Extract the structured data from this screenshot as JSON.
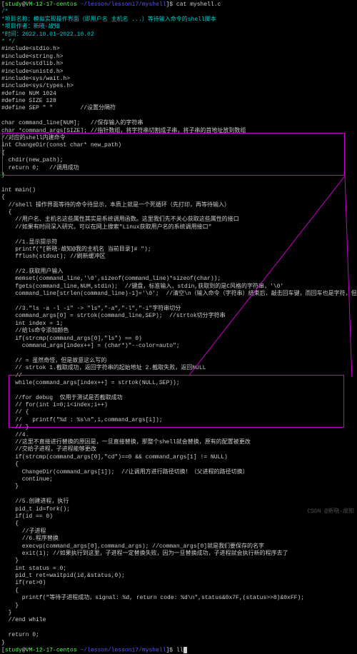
{
  "prompt1": {
    "user": "study",
    "host": "VM-12-17-centos",
    "path": "~/lesson/lesson17/myshell",
    "cmd": "cat myshell.c"
  },
  "header_comments": [
    "/*",
    "*项目名称：模拟实现操作界面（即用户名 主机名 ...）等待输入命令的shell脚本",
    "*项目作者：新晓·故知",
    "*时间：2022.10.01—2022.10.02",
    "* */",
    ""
  ],
  "includes": [
    "#include<stdio.h>",
    "#include<string.h>",
    "#include<stdlib.h>",
    "#include<unistd.h>",
    "#include<sys/wait.h>",
    "#include<sys/types.h>",
    ""
  ],
  "defines": [
    "#define NUM 1024",
    "#define SIZE 128",
    "#define SEP \" \"        //设置分隔符",
    "",
    "char command_line[NUM];   //保存输入的字符串",
    "char *command_args[SIZE]; //指针数组，将字符串切割成子串，将子串的首地址放到数组",
    ""
  ],
  "changedir_block": [
    "//对应的shell内建命令",
    "int ChangeDir(const char* new_path)",
    "{",
    "  chdir(new_path);",
    "  return 0;   //调用成功",
    "}"
  ],
  "main_start": [
    "",
    "int main()",
    "{",
    "  //shell 操作界面等待的命令待显示，本质上就是一个死循环（先打印，再等待输入）",
    "  {",
    "    //用户名、主机名这些属性其实是系统调用函数。这里我们先不关心获取这些属性的接口",
    "    //如果有时间深入研究，可以在网上搜索\"Linux获取用户名的系统调用接口\"",
    "",
    "    //1.显示提示符",
    "    printf(\"[新晓·故知@我的主机名 当前目录]# \");",
    "    fflush(stdout); //刷新缓冲区",
    "",
    "    //2.获取用户输入",
    "    memset(command_line,'\\0',sizeof(command_line)*sizeof(char));",
    "    fgets(command_line,NUM,stdin);  //键盘，标准输入，stdin,获取到的是C风格的字符串，'\\0'",
    "    command_line[strlen(command_line)-1]='\\0';  //清空\\n（输入命令（字符串）结束后，敲击回车键，而回车也是字符，但不可显）",
    "",
    "    //3.\"ls -a -l -i\" -> \"ls\",\"-a\",\"-l\",\"-i\"字符串切分",
    "    command_args[0] = strtok(command_line,SEP);  //strtok切分字符串",
    "    int index = 1;",
    "    //给ls命令添加颜色",
    "    if(strcmp(command_args[0],\"ls\") == 0)",
    "      command_args[index++] = (char*)\"--color=auto\";",
    "",
    "    // = 虽然奇怪，但是故意这么写的",
    "    // strtok 1.截取成功，返回字符串的起始地址 2.截取失败，返回NULL",
    "    //",
    "    while(command_args[index++] = strtok(NULL,SEP));",
    "",
    "    //for debug  仅用于测试是否截取成功",
    "    // for(int i=0;i<index;i++)",
    "    // {",
    "    //   printf(\"%d : %s\\n\",i,command_args[i]);",
    "    // }",
    ""
  ],
  "cd_block": [
    "    //4.",
    "    //这里不直接进行替换的原因是，一旦直接替换，那整个shell就会替换，原有的配置被更改",
    "    //交给子进程，子进程能够更改",
    "    if(strcmp(command_args[0],\"cd\")==0 && command_args[1] != NULL)",
    "    {",
    "      ChangeDir(command_args[1]);  //让调用方进行路径切换！（父进程的路径切换）",
    "      continue;",
    "    }"
  ],
  "fork_block": [
    "",
    "    //5.创建进程，执行",
    "    pid_t id=fork();",
    "    if(id == 0)",
    "    {",
    "      //子进程",
    "      //6.程序替换",
    "      execvp(command_args[0],command_args); //comman_args[0]就是我们要保存的名字",
    "      exit(1); //如果执行到这里，子进程一定替换失败，因为一旦替换成功，子进程就会执行新的程序去了",
    "    }",
    "    int status = 0;",
    "    pid_t ret=waitpid(id,&status,0);",
    "    if(ret>0)",
    "    {",
    "      printf(\"等待子进程成功，signal: %d, return code: %d\\n\",status&0x7F,(status>>8)&0xFF);",
    "    }",
    "  }",
    "  //end while",
    "",
    "  return 0;",
    "}"
  ],
  "prompt2": {
    "user": "study",
    "host": "VM-12-17-centos",
    "path": "~/lesson/lesson17/myshell",
    "cmd": "ll"
  },
  "watermark": "CSDN @新晓·故知"
}
